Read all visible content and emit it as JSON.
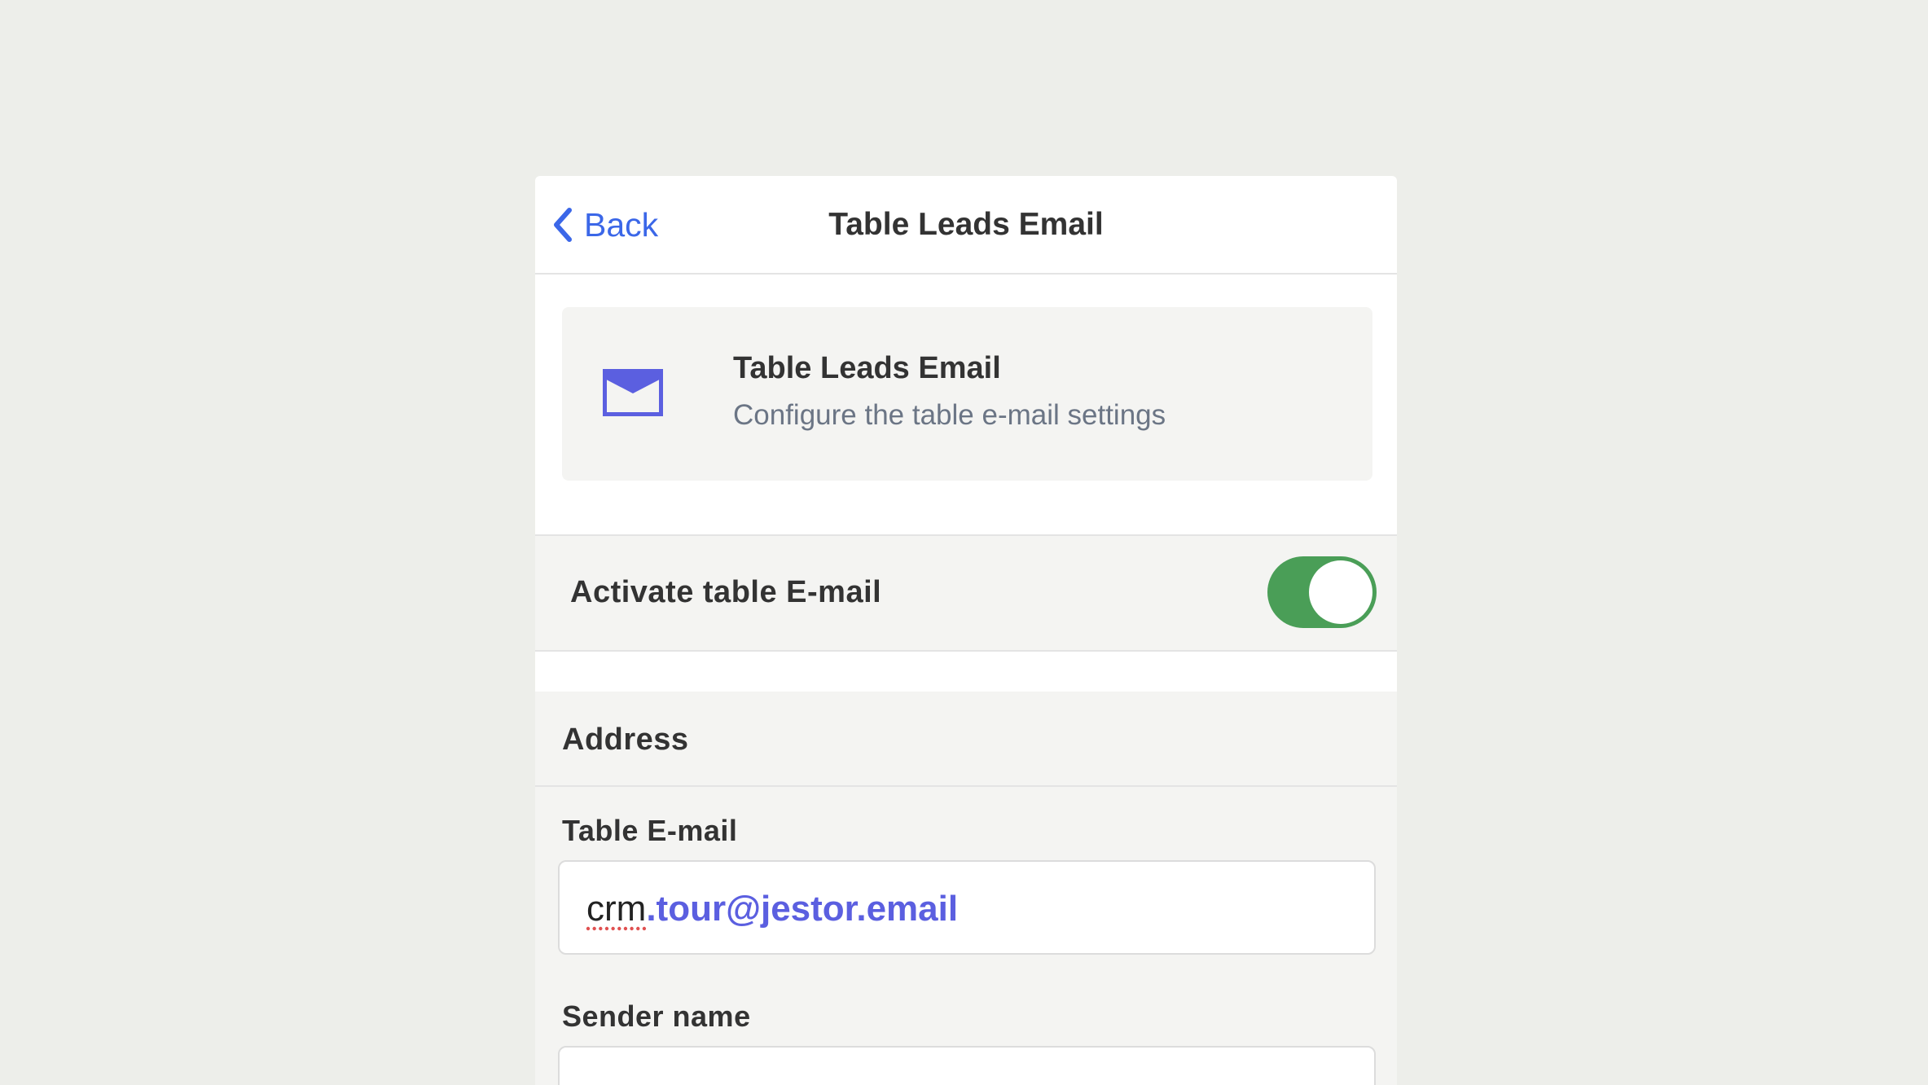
{
  "header": {
    "back_label": "Back",
    "title": "Table Leads Email"
  },
  "info_card": {
    "icon": "mail-icon",
    "title": "Table Leads Email",
    "subtitle": "Configure the table e-mail settings"
  },
  "activate": {
    "label": "Activate table E-mail",
    "enabled": true
  },
  "address": {
    "section_title": "Address",
    "table_email_label": "Table E-mail",
    "table_email_prefix": "crm",
    "table_email_domain": ".tour@jestor.email",
    "sender_name_label": "Sender name",
    "sender_name_value": ""
  },
  "colors": {
    "accent_blue": "#3b67e8",
    "toggle_on": "#4a9e57",
    "email_domain": "#5b5fe0",
    "icon_purple": "#5b5fe0"
  }
}
